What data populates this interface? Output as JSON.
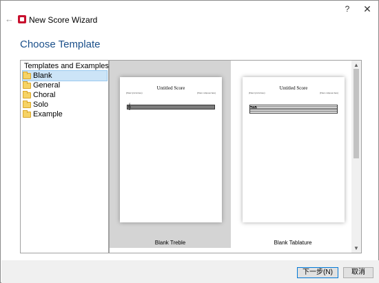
{
  "window": {
    "title": "New Score Wizard",
    "help_label": "?",
    "close_label": "✕",
    "back_label": "←"
  },
  "page": {
    "title": "Choose Template"
  },
  "tree": {
    "header": "Templates and Examples",
    "items": [
      {
        "label": "Blank",
        "selected": true
      },
      {
        "label": "General",
        "selected": false
      },
      {
        "label": "Choral",
        "selected": false
      },
      {
        "label": "Solo",
        "selected": false
      },
      {
        "label": "Example",
        "selected": false
      }
    ]
  },
  "templates": [
    {
      "name": "Blank Treble",
      "score_title": "Untitled Score",
      "lyricist": "(Enter lyricist here)",
      "composer": "(Enter composer here)",
      "clef": "𝄞",
      "staff_type": "treble",
      "selected": true
    },
    {
      "name": "Blank Tablature",
      "score_title": "Untitled Score",
      "lyricist": "(Enter lyricist here)",
      "composer": "(Enter composer here)",
      "clef": "TAB",
      "staff_type": "tab",
      "selected": false
    }
  ],
  "buttons": {
    "next": "下一步(N)",
    "cancel": "取消"
  },
  "colors": {
    "title_blue": "#1a4f8a",
    "selection_bg": "#cce4f7",
    "tile_selected_bg": "#d4d4d4",
    "logo_red": "#c8102e"
  }
}
